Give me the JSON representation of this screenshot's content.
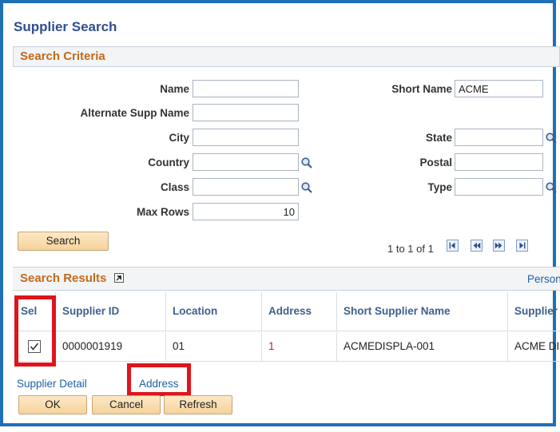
{
  "page": {
    "title": "Supplier Search"
  },
  "criteria": {
    "section_title": "Search Criteria",
    "fields": {
      "name": {
        "label": "Name",
        "value": ""
      },
      "alt_name": {
        "label": "Alternate Supp Name",
        "value": ""
      },
      "city": {
        "label": "City",
        "value": ""
      },
      "country": {
        "label": "Country",
        "value": ""
      },
      "class": {
        "label": "Class",
        "value": ""
      },
      "max_rows": {
        "label": "Max Rows",
        "value": "10"
      },
      "short_name": {
        "label": "Short Name",
        "value": "ACME"
      },
      "state": {
        "label": "State",
        "value": ""
      },
      "postal": {
        "label": "Postal",
        "value": ""
      },
      "type": {
        "label": "Type",
        "value": ""
      }
    },
    "search_button": "Search",
    "pager_text": "1 to 1 of 1"
  },
  "results": {
    "section_title": "Search Results",
    "personalize_link": "Person",
    "columns": [
      "Sel",
      "Supplier ID",
      "Location",
      "Address",
      "Short Supplier Name",
      "Supplier N"
    ],
    "rows": [
      {
        "selected": true,
        "supplier_id": "0000001919",
        "location": "01",
        "address": "1",
        "short_name": "ACMEDISPLA-001",
        "supplier_name": "ACME DIS"
      }
    ]
  },
  "footer": {
    "supplier_detail_link": "Supplier Detail",
    "address_link": "Address",
    "ok_button": "OK",
    "cancel_button": "Cancel",
    "refresh_button": "Refresh"
  },
  "colors": {
    "highlight": "#e0141b",
    "frame": "#1f6fb5",
    "section_title": "#c26a1a",
    "link": "#1f5fa8"
  }
}
